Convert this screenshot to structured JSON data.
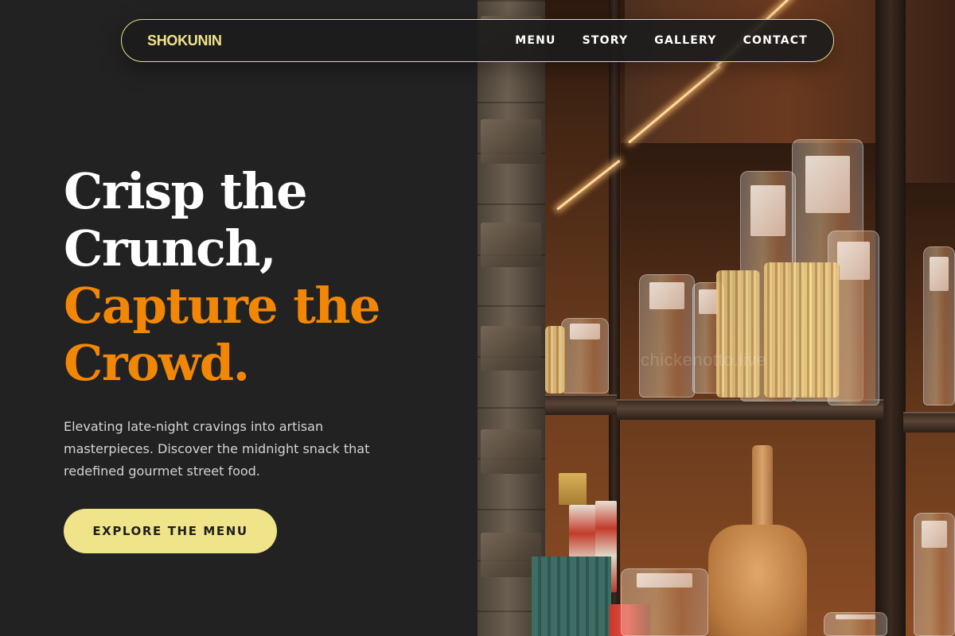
{
  "nav": {
    "brand": "SHOKUNIN",
    "links": [
      {
        "label": "MENU"
      },
      {
        "label": "STORY"
      },
      {
        "label": "GALLERY"
      },
      {
        "label": "CONTACT"
      }
    ]
  },
  "hero": {
    "headline_line1": "Crisp the",
    "headline_line2": "Crunch,",
    "headline_line3": "Capture the",
    "headline_line4": "Crowd.",
    "subtext": "Elevating late-night cravings into artisan masterpieces. Discover the midnight snack that redefined gourmet street food.",
    "cta_label": "EXPLORE THE MENU"
  },
  "image": {
    "watermark": "chickenotto.live"
  },
  "colors": {
    "background": "#222222",
    "accent_yellow": "#efe48a",
    "accent_orange": "#f28705",
    "text_white": "#ffffff",
    "text_muted": "#d4d4d4"
  }
}
